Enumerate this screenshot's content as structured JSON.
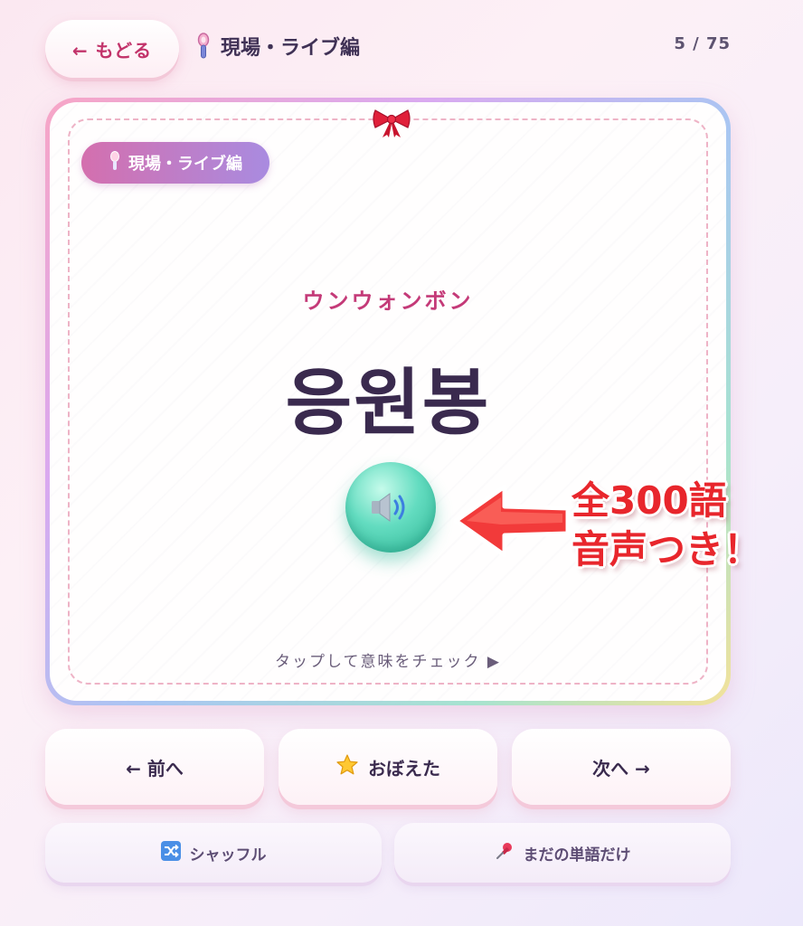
{
  "header": {
    "back_label": "← もどる",
    "topic_title": "現場・ライブ編",
    "progress": "5 / 75"
  },
  "card": {
    "category_label": "現場・ライブ編",
    "reading": "ウンウォンボン",
    "word": "응원봉",
    "audio_icon": "speaker-icon",
    "tap_hint": "タップして意味をチェック ▶"
  },
  "promo": {
    "line1": "全300語",
    "line2": "音声つき！"
  },
  "nav": {
    "prev_label": "← 前へ",
    "memorized_label": "おぼえた",
    "next_label": "次へ →"
  },
  "actions": {
    "shuffle_label": "シャッフル",
    "unlearned_label": "まだの単語だけ"
  },
  "colors": {
    "accent_pink": "#c43a78",
    "promo_red": "#e8262c",
    "audio_teal": "#3fc4a3"
  }
}
